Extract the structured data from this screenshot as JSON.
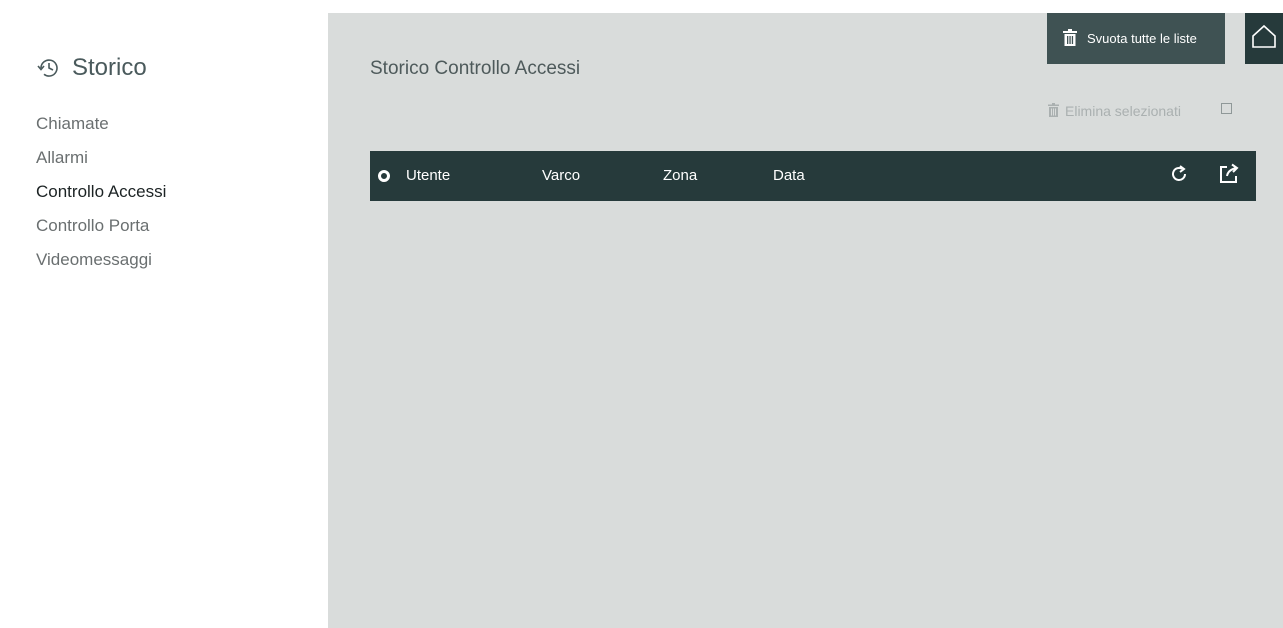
{
  "sidebar": {
    "title": "Storico",
    "title_icon": "history-icon",
    "items": [
      {
        "label": "Chiamate",
        "active": false
      },
      {
        "label": "Allarmi",
        "active": false
      },
      {
        "label": "Controllo Accessi",
        "active": true
      },
      {
        "label": "Controllo Porta",
        "active": false
      },
      {
        "label": "Videomessaggi",
        "active": false
      }
    ]
  },
  "main": {
    "title": "Storico Controllo Accessi",
    "toolbar": {
      "empty_all_label": "Svuota tutte le liste",
      "empty_all_icon": "trash-icon",
      "home_icon": "home-icon",
      "delete_selected_label": "Elimina selezionati",
      "delete_selected_icon": "trash-icon"
    },
    "table": {
      "columns": [
        "Utente",
        "Varco",
        "Zona",
        "Data"
      ],
      "rows": [],
      "actions": [
        "refresh-icon",
        "export-icon"
      ]
    }
  },
  "colors": {
    "accent_dark": "#263a3b",
    "button": "#3f5253",
    "background": "#d9dcdb"
  }
}
